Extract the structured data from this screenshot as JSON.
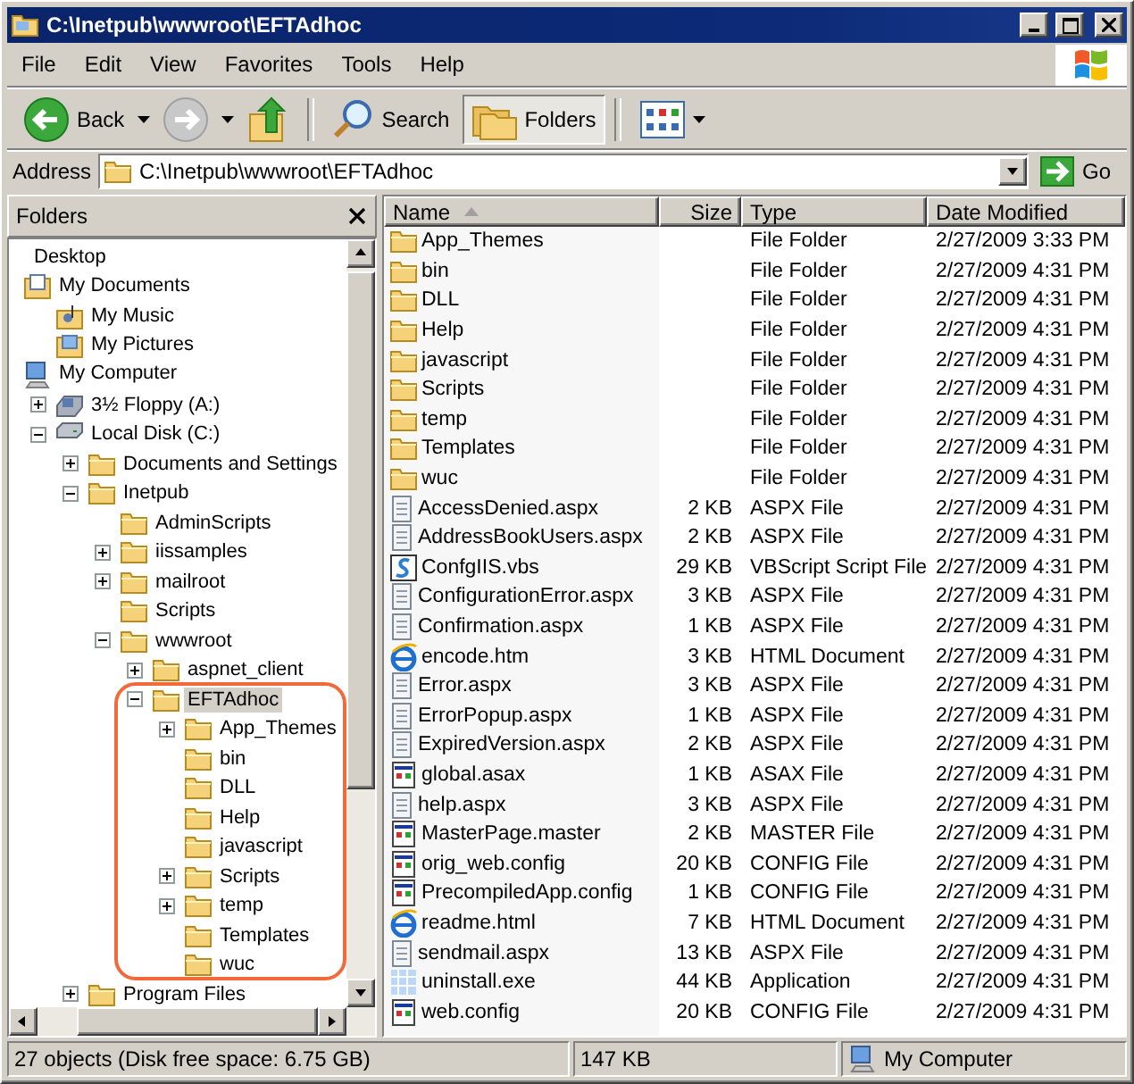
{
  "window": {
    "title": "C:\\Inetpub\\wwwroot\\EFTAdhoc"
  },
  "menu": [
    "File",
    "Edit",
    "View",
    "Favorites",
    "Tools",
    "Help"
  ],
  "toolbar": [
    {
      "kind": "back",
      "label": "Back",
      "disabled": false
    },
    {
      "kind": "forward",
      "disabled": true
    },
    {
      "kind": "up",
      "disabled": false
    },
    {
      "kind": "search",
      "label": "Search",
      "selected": false
    },
    {
      "kind": "folders",
      "label": "Folders",
      "selected": true
    },
    {
      "kind": "views",
      "selected": false
    }
  ],
  "address": {
    "label": "Address",
    "value": "C:\\Inetpub\\wwwroot\\EFTAdhoc",
    "go": "Go"
  },
  "folders_pane": {
    "title": "Folders",
    "tree": [
      {
        "label": "Desktop",
        "selected": false,
        "children": [
          {
            "label": "My Documents",
            "kind": "documents",
            "selected": false,
            "children": [
              {
                "label": "My Music",
                "kind": "music",
                "selected": false
              },
              {
                "label": "My Pictures",
                "kind": "pictures",
                "selected": false
              }
            ]
          },
          {
            "label": "My Computer",
            "kind": "computer",
            "selected": false,
            "children": [
              {
                "label": "3½ Floppy (A:)",
                "kind": "floppy",
                "expanded": false,
                "selected": false
              },
              {
                "label": "Local Disk (C:)",
                "kind": "disk",
                "expanded": true,
                "selected": false,
                "children": [
                  {
                    "label": "Documents and Settings",
                    "kind": "folder",
                    "expanded": false,
                    "selected": false
                  },
                  {
                    "label": "Inetpub",
                    "kind": "folder",
                    "expanded": true,
                    "selected": false,
                    "children": [
                      {
                        "label": "AdminScripts",
                        "kind": "folder",
                        "selected": false
                      },
                      {
                        "label": "iissamples",
                        "kind": "folder",
                        "expanded": false,
                        "selected": false
                      },
                      {
                        "label": "mailroot",
                        "kind": "folder",
                        "expanded": false,
                        "selected": false
                      },
                      {
                        "label": "Scripts",
                        "kind": "folder",
                        "selected": false
                      },
                      {
                        "label": "wwwroot",
                        "kind": "folder",
                        "expanded": true,
                        "selected": false,
                        "children": [
                          {
                            "label": "aspnet_client",
                            "kind": "folder",
                            "expanded": false,
                            "selected": false
                          },
                          {
                            "label": "EFTAdhoc",
                            "kind": "folder",
                            "expanded": true,
                            "selected": true,
                            "highlighted": true,
                            "children": [
                              {
                                "label": "App_Themes",
                                "kind": "folder",
                                "expanded": false,
                                "selected": false
                              },
                              {
                                "label": "bin",
                                "kind": "folder",
                                "selected": false
                              },
                              {
                                "label": "DLL",
                                "kind": "folder",
                                "selected": false
                              },
                              {
                                "label": "Help",
                                "kind": "folder",
                                "selected": false
                              },
                              {
                                "label": "javascript",
                                "kind": "folder",
                                "selected": false
                              },
                              {
                                "label": "Scripts",
                                "kind": "folder",
                                "expanded": false,
                                "selected": false
                              },
                              {
                                "label": "temp",
                                "kind": "folder",
                                "expanded": false,
                                "selected": false
                              },
                              {
                                "label": "Templates",
                                "kind": "folder",
                                "selected": false
                              },
                              {
                                "label": "wuc",
                                "kind": "folder",
                                "selected": false
                              }
                            ]
                          }
                        ]
                      }
                    ]
                  },
                  {
                    "label": "Program Files",
                    "kind": "folder",
                    "expanded": false,
                    "selected": false
                  }
                ]
              }
            ]
          }
        ]
      }
    ]
  },
  "file_list": {
    "columns": [
      {
        "label": "Name",
        "sorted": true
      },
      {
        "label": "Size",
        "sorted": false
      },
      {
        "label": "Type",
        "sorted": false
      },
      {
        "label": "Date Modified",
        "sorted": false
      }
    ],
    "rows": [
      {
        "kind": "folder",
        "name": "App_Themes",
        "type": "File Folder",
        "date": "2/27/2009 3:33 PM",
        "selected": false
      },
      {
        "kind": "folder",
        "name": "bin",
        "type": "File Folder",
        "date": "2/27/2009 4:31 PM",
        "selected": false
      },
      {
        "kind": "folder",
        "name": "DLL",
        "type": "File Folder",
        "date": "2/27/2009 4:31 PM",
        "selected": false
      },
      {
        "kind": "folder",
        "name": "Help",
        "type": "File Folder",
        "date": "2/27/2009 4:31 PM",
        "selected": false
      },
      {
        "kind": "folder",
        "name": "javascript",
        "type": "File Folder",
        "date": "2/27/2009 4:31 PM",
        "selected": false
      },
      {
        "kind": "folder",
        "name": "Scripts",
        "type": "File Folder",
        "date": "2/27/2009 4:31 PM",
        "selected": false
      },
      {
        "kind": "folder",
        "name": "temp",
        "type": "File Folder",
        "date": "2/27/2009 4:31 PM",
        "selected": false
      },
      {
        "kind": "folder",
        "name": "Templates",
        "type": "File Folder",
        "date": "2/27/2009 4:31 PM",
        "selected": false
      },
      {
        "kind": "folder",
        "name": "wuc",
        "type": "File Folder",
        "date": "2/27/2009 4:31 PM",
        "selected": false
      },
      {
        "kind": "page",
        "name": "AccessDenied.aspx",
        "size": "2 KB",
        "type": "ASPX File",
        "date": "2/27/2009 4:31 PM",
        "selected": false
      },
      {
        "kind": "page",
        "name": "AddressBookUsers.aspx",
        "size": "2 KB",
        "type": "ASPX File",
        "date": "2/27/2009 4:31 PM",
        "selected": false
      },
      {
        "kind": "script",
        "name": "ConfgIIS.vbs",
        "size": "29 KB",
        "type": "VBScript Script File",
        "date": "2/27/2009 4:31 PM",
        "selected": false
      },
      {
        "kind": "page",
        "name": "ConfigurationError.aspx",
        "size": "3 KB",
        "type": "ASPX File",
        "date": "2/27/2009 4:31 PM",
        "selected": false
      },
      {
        "kind": "page",
        "name": "Confirmation.aspx",
        "size": "1 KB",
        "type": "ASPX File",
        "date": "2/27/2009 4:31 PM",
        "selected": false
      },
      {
        "kind": "web",
        "name": "encode.htm",
        "size": "3 KB",
        "type": "HTML Document",
        "date": "2/27/2009 4:31 PM",
        "selected": false
      },
      {
        "kind": "page",
        "name": "Error.aspx",
        "size": "3 KB",
        "type": "ASPX File",
        "date": "2/27/2009 4:31 PM",
        "selected": false
      },
      {
        "kind": "page",
        "name": "ErrorPopup.aspx",
        "size": "1 KB",
        "type": "ASPX File",
        "date": "2/27/2009 4:31 PM",
        "selected": false
      },
      {
        "kind": "page",
        "name": "ExpiredVersion.aspx",
        "size": "2 KB",
        "type": "ASPX File",
        "date": "2/27/2009 4:31 PM",
        "selected": false
      },
      {
        "kind": "window",
        "name": "global.asax",
        "size": "1 KB",
        "type": "ASAX File",
        "date": "2/27/2009 4:31 PM",
        "selected": false
      },
      {
        "kind": "page",
        "name": "help.aspx",
        "size": "3 KB",
        "type": "ASPX File",
        "date": "2/27/2009 4:31 PM",
        "selected": false
      },
      {
        "kind": "window",
        "name": "MasterPage.master",
        "size": "2 KB",
        "type": "MASTER File",
        "date": "2/27/2009 4:31 PM",
        "selected": false
      },
      {
        "kind": "window",
        "name": "orig_web.config",
        "size": "20 KB",
        "type": "CONFIG File",
        "date": "2/27/2009 4:31 PM",
        "selected": false
      },
      {
        "kind": "window",
        "name": "PrecompiledApp.config",
        "size": "1 KB",
        "type": "CONFIG File",
        "date": "2/27/2009 4:31 PM",
        "selected": false
      },
      {
        "kind": "web",
        "name": "readme.html",
        "size": "7 KB",
        "type": "HTML Document",
        "date": "2/27/2009 4:31 PM",
        "selected": false
      },
      {
        "kind": "page",
        "name": "sendmail.aspx",
        "size": "13 KB",
        "type": "ASPX File",
        "date": "2/27/2009 4:31 PM",
        "selected": false
      },
      {
        "kind": "app",
        "name": "uninstall.exe",
        "size": "44 KB",
        "type": "Application",
        "date": "2/27/2009 4:31 PM",
        "selected": false
      },
      {
        "kind": "window",
        "name": "web.config",
        "size": "20 KB",
        "type": "CONFIG File",
        "date": "2/27/2009 4:31 PM",
        "selected": false
      }
    ]
  },
  "status_bar": [
    "27 objects (Disk free space: 6.75 GB)",
    "147 KB",
    "My Computer"
  ]
}
